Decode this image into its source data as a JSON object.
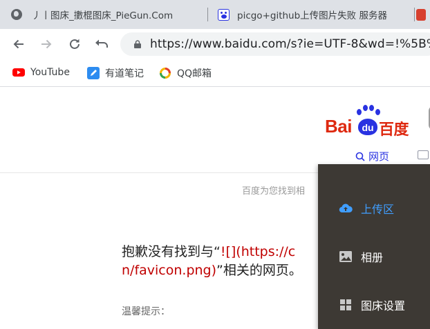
{
  "tabs": [
    {
      "title": "丿丨图床_擻棍图床_PieGun.Com",
      "icon": "globe-icon"
    },
    {
      "title": "picgo+github上传图片失败 服务器",
      "icon": "baidu-paw-icon"
    },
    {
      "title": "",
      "icon": "red-site-icon"
    }
  ],
  "toolbar": {
    "url": "https://www.baidu.com/s?ie=UTF-8&wd=!%5B%"
  },
  "bookmarks": [
    {
      "label": "YouTube",
      "icon": "youtube-icon",
      "color": "#ff0000"
    },
    {
      "label": "有道笔记",
      "icon": "youdao-note-icon",
      "color": "#2d8cf0"
    },
    {
      "label": "QQ邮箱",
      "icon": "qq-mail-icon",
      "color": "#f0a000"
    }
  ],
  "page": {
    "logo_bai": "Bai",
    "logo_du": "du",
    "logo_cn": "百度",
    "nav_web": "网页",
    "result_tip": "百度为您找到相",
    "sorry_line1_prefix": "抱歉没有找到与“",
    "sorry_line1_keyword": "![](https://c",
    "sorry_line2_keyword": "n/favicon.png)",
    "sorry_line2_suffix": "”相关的网页。",
    "hint": "温馨提示："
  },
  "menu": {
    "items": [
      {
        "label": "上传区",
        "icon": "cloud-upload-icon",
        "active": true
      },
      {
        "label": "相册",
        "icon": "picture-icon",
        "active": false
      },
      {
        "label": "图床设置",
        "icon": "grid-icon",
        "active": false
      }
    ],
    "accent": "#409eff",
    "background": "#3d3934"
  },
  "colors": {
    "baidu_red": "#de2910",
    "baidu_blue": "#2932e1",
    "keyword_red": "#c00000"
  }
}
